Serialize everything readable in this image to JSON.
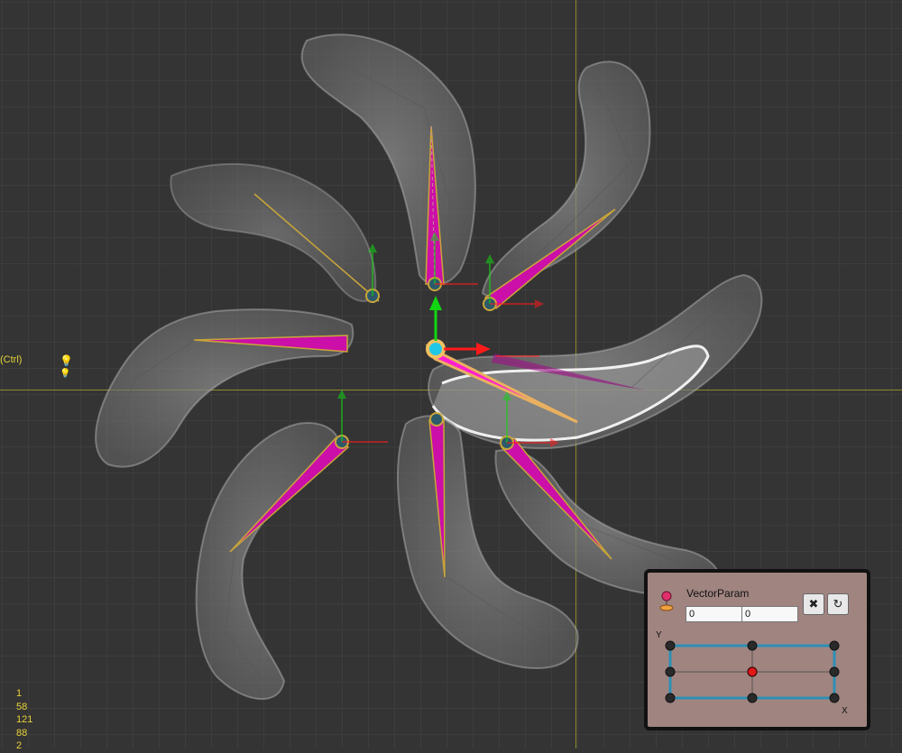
{
  "viewport": {
    "modifier_hint": "(Ctrl)",
    "icons": [
      "light-bulb-icon",
      "light-bulb-small-icon"
    ],
    "stats": [
      "1",
      "58",
      "121",
      "88",
      "2"
    ]
  },
  "param_panel": {
    "name": "VectorParam",
    "value_x": "0",
    "value_y": "0",
    "axis_y_label": "Y",
    "axis_x_label": "X",
    "clear_icon": "✖",
    "reset_icon": "↻",
    "grid_columns": 3,
    "grid_rows": 3,
    "selected_point": {
      "x": 0,
      "y": 0
    }
  },
  "colors": {
    "background": "#343434",
    "grid_line": "#3d3d3d",
    "origin_axis": "#8f8a2a",
    "bone": "#cc0fa8",
    "bone_selected": "#ff1fd0",
    "mesh": "#9a9a9a",
    "gizmo_x": "#ff1a1a",
    "gizmo_y": "#12d612",
    "panel_bg": "#a08480",
    "grid_point": "#2e8fb5"
  }
}
